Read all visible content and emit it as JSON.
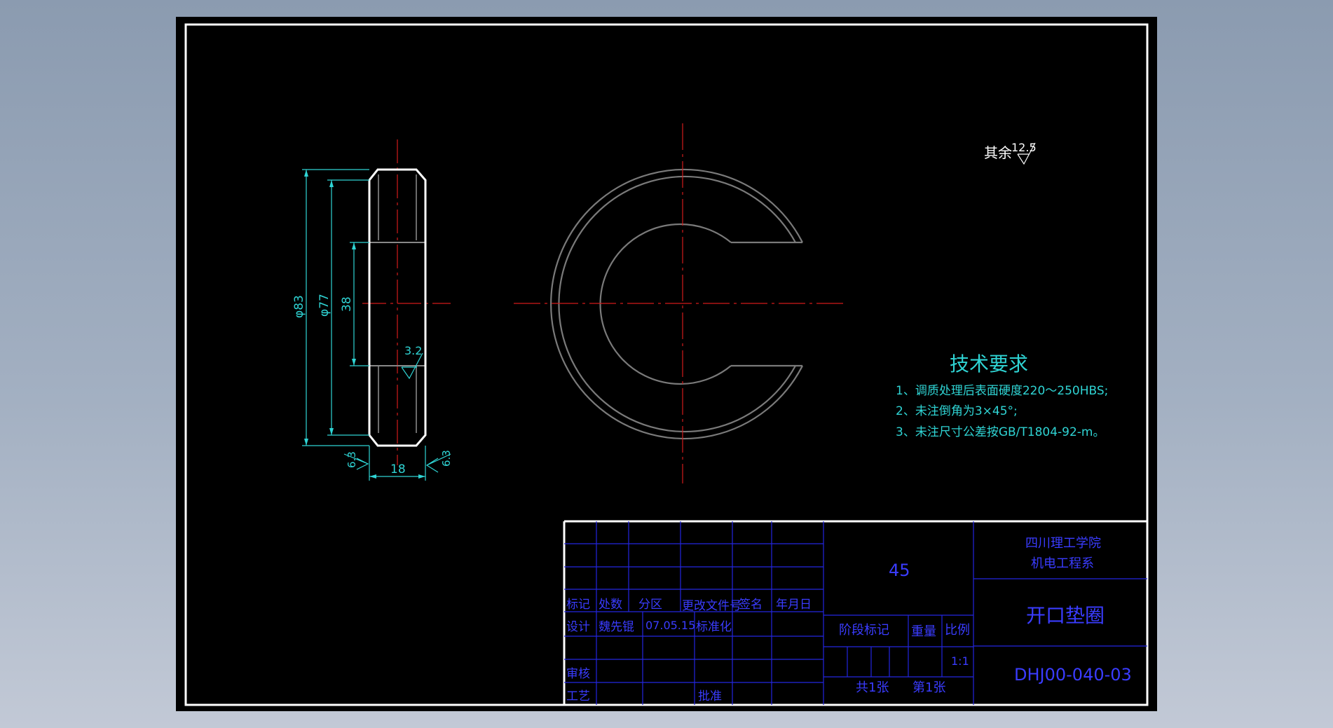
{
  "colors": {
    "background": "#000000",
    "outline": "#ffffff",
    "center_line": "#d11a1a",
    "dimension": "#2fd4d4",
    "hidden_ring": "#7a7a7a",
    "title_block_lines": "#2326e0",
    "title_block_text": "#3a3cff"
  },
  "side_view": {
    "dims": {
      "outer_diameter": "φ83",
      "inner_diameter": "φ77",
      "slot_height": "38",
      "thickness": "18",
      "roughness_inner": "3.2",
      "roughness_left": "6.3",
      "roughness_right": "6.3"
    }
  },
  "surface_finish": {
    "label": "其余",
    "value": "12.5"
  },
  "tech_requirements": {
    "title": "技术要求",
    "items": [
      "1、调质处理后表面硬度220～250HBS;",
      "2、未注倒角为3×45°;",
      "3、未注尺寸公差按GB/T1804-92-m。"
    ]
  },
  "title_block": {
    "headers": {
      "mark": "标记",
      "count": "处数",
      "zone": "分区",
      "change_doc": "更改文件号",
      "signature": "签名",
      "date": "年月日"
    },
    "row_design": {
      "label": "设计",
      "designer": "魏先锟",
      "date": "07.05.15",
      "standardize": "标准化"
    },
    "review_label": "审核",
    "process_label": "工艺",
    "approve_label": "批准",
    "material": "45",
    "stage_mark": "阶段标记",
    "weight": "重量",
    "scale_label": "比例",
    "scale_value": "1:1",
    "sheets_total": "共1张",
    "sheet_number": "第1张",
    "institution_line1": "四川理工学院",
    "institution_line2": "机电工程系",
    "part_name": "开口垫圈",
    "drawing_number": "DHJ00-040-03"
  }
}
